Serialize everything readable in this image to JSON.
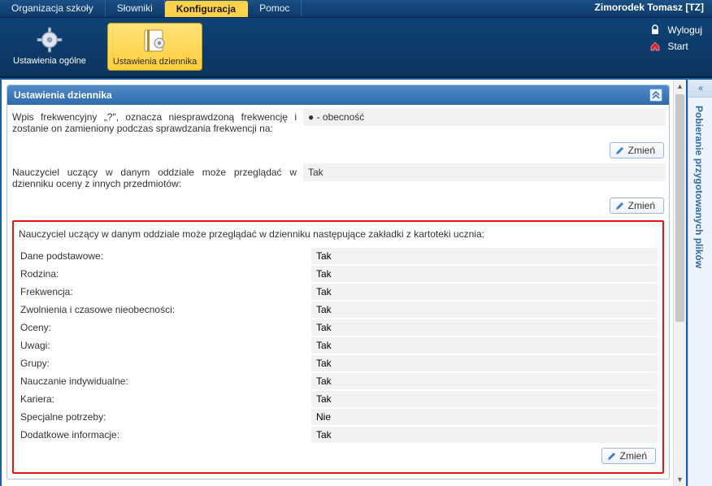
{
  "topbar": {
    "tabs": [
      {
        "label": "Organizacja szkoły",
        "active": false
      },
      {
        "label": "Słowniki",
        "active": false
      },
      {
        "label": "Konfiguracja",
        "active": true
      },
      {
        "label": "Pomoc",
        "active": false
      }
    ],
    "user": "Zimorodek Tomasz [TZ]"
  },
  "ribbon": {
    "buttons": [
      {
        "label": "Ustawienia ogólne",
        "active": false
      },
      {
        "label": "Ustawienia dziennika",
        "active": true
      }
    ],
    "links": {
      "logout": "Wyloguj",
      "start": "Start"
    }
  },
  "panel": {
    "title": "Ustawienia dziennika",
    "row1_label": "Wpis frekwencyjny „?\", oznacza niesprawdzoną frekwencję i zostanie on zamieniony podczas sprawdzania frekwencji na:",
    "row1_value": "● - obecność",
    "row2_label": "Nauczyciel uczący w danym oddziale może przeglądać w dzienniku oceny z innych przedmiotów:",
    "row2_value": "Tak",
    "change_btn": "Zmień"
  },
  "section": {
    "title": "Nauczyciel uczący w danym oddziale może przeglądać w dzienniku następujące zakładki z kartoteki ucznia:",
    "rows": [
      {
        "label": "Dane podstawowe:",
        "value": "Tak"
      },
      {
        "label": "Rodzina:",
        "value": "Tak"
      },
      {
        "label": "Frekwencja:",
        "value": "Tak"
      },
      {
        "label": "Zwolnienia i czasowe nieobecności:",
        "value": "Tak"
      },
      {
        "label": "Oceny:",
        "value": "Tak"
      },
      {
        "label": "Uwagi:",
        "value": "Tak"
      },
      {
        "label": "Grupy:",
        "value": "Tak"
      },
      {
        "label": "Nauczanie indywidualne:",
        "value": "Tak"
      },
      {
        "label": "Kariera:",
        "value": "Tak"
      },
      {
        "label": "Specjalne potrzeby:",
        "value": "Nie"
      },
      {
        "label": "Dodatkowe informacje:",
        "value": "Tak"
      }
    ],
    "change_btn": "Zmień"
  },
  "sidebar": {
    "toggle": "«",
    "label": "Pobieranie przygotowanych plików"
  }
}
